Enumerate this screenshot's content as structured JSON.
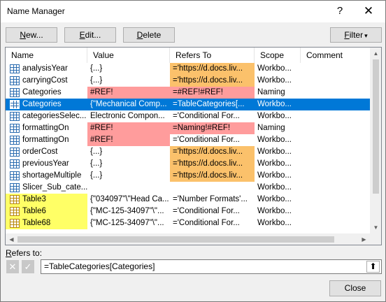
{
  "window": {
    "title": "Name Manager",
    "help_label": "?",
    "close_label": "✕"
  },
  "toolbar": {
    "new_prefix": "N",
    "new_rest": "ew...",
    "edit_prefix": "E",
    "edit_rest": "dit...",
    "delete_prefix": "D",
    "delete_rest": "elete",
    "filter_prefix": "F",
    "filter_rest": "ilter",
    "filter_arrow": "▾"
  },
  "list": {
    "columns": [
      "Name",
      "Value",
      "Refers To",
      "Scope",
      "Comment"
    ],
    "rows": [
      {
        "name": "analysisYear",
        "value": "{...}",
        "refers": "='https://d.docs.liv...",
        "scope": "Workbo...",
        "icon": "named-range-icon",
        "hl_value": "",
        "hl_refers": "orange",
        "hl_name": ""
      },
      {
        "name": "carryingCost",
        "value": "{...}",
        "refers": "='https://d.docs.liv...",
        "scope": "Workbo...",
        "icon": "named-range-icon",
        "hl_value": "",
        "hl_refers": "orange",
        "hl_name": ""
      },
      {
        "name": "Categories",
        "value": "#REF!",
        "refers": "=#REF!#REF!",
        "scope": "Naming",
        "icon": "named-range-icon",
        "hl_value": "red",
        "hl_refers": "red",
        "hl_name": ""
      },
      {
        "name": "Categories",
        "value": "{\"Mechanical Comp...",
        "refers": "=TableCategories[...",
        "scope": "Workbo...",
        "icon": "named-range-icon",
        "hl_value": "",
        "hl_refers": "",
        "hl_name": "",
        "selected": true
      },
      {
        "name": "categoriesSelec...",
        "value": "Electronic Compon...",
        "refers": "='Conditional For...",
        "scope": "Workbo...",
        "icon": "named-range-icon",
        "hl_value": "",
        "hl_refers": "",
        "hl_name": ""
      },
      {
        "name": "formattingOn",
        "value": "#REF!",
        "refers": "=Naming!#REF!",
        "scope": "Naming",
        "icon": "named-range-icon",
        "hl_value": "red",
        "hl_refers": "red",
        "hl_name": ""
      },
      {
        "name": "formattingOn",
        "value": "#REF!",
        "refers": "='Conditional For...",
        "scope": "Workbo...",
        "icon": "named-range-icon",
        "hl_value": "red",
        "hl_refers": "",
        "hl_name": ""
      },
      {
        "name": "orderCost",
        "value": "{...}",
        "refers": "='https://d.docs.liv...",
        "scope": "Workbo...",
        "icon": "named-range-icon",
        "hl_value": "",
        "hl_refers": "orange",
        "hl_name": ""
      },
      {
        "name": "previousYear",
        "value": "{...}",
        "refers": "='https://d.docs.liv...",
        "scope": "Workbo...",
        "icon": "named-range-icon",
        "hl_value": "",
        "hl_refers": "orange",
        "hl_name": ""
      },
      {
        "name": "shortageMultiple",
        "value": "{...}",
        "refers": "='https://d.docs.liv...",
        "scope": "Workbo...",
        "icon": "named-range-icon",
        "hl_value": "",
        "hl_refers": "orange",
        "hl_name": ""
      },
      {
        "name": "Slicer_Sub_cate...",
        "value": "",
        "refers": "",
        "scope": "Workbo...",
        "icon": "named-range-icon",
        "hl_value": "",
        "hl_refers": "",
        "hl_name": ""
      },
      {
        "name": "Table3",
        "value": "{\"034097\"\\\"Head Ca...",
        "refers": "='Number Formats'...",
        "scope": "Workbo...",
        "icon": "table-icon",
        "hl_value": "",
        "hl_refers": "",
        "hl_name": "yellow"
      },
      {
        "name": "Table6",
        "value": "{\"MC-125-34097\"\\\"...",
        "refers": "='Conditional For...",
        "scope": "Workbo...",
        "icon": "table-icon",
        "hl_value": "",
        "hl_refers": "",
        "hl_name": "yellow"
      },
      {
        "name": "Table68",
        "value": "{\"MC-125-34097\"\\\"...",
        "refers": "='Conditional For...",
        "scope": "Workbo...",
        "icon": "table-icon",
        "hl_value": "",
        "hl_refers": "",
        "hl_name": "yellow"
      }
    ]
  },
  "refers_to": {
    "label_prefix": "R",
    "label_rest": "efers to:",
    "value": "=TableCategories[Categories]",
    "cancel_icon": "✕",
    "confirm_icon": "✓",
    "collapse_icon": "⬆"
  },
  "footer": {
    "close_label": "Close"
  }
}
